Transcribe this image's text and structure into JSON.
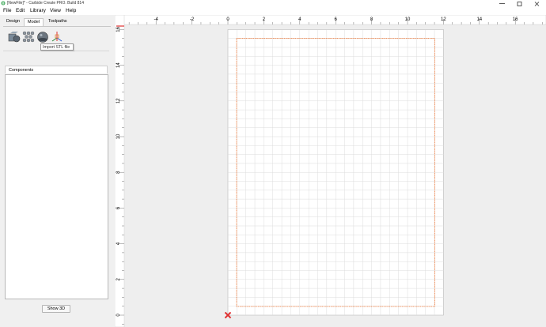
{
  "window": {
    "title": "[NewFile]* - Carbide Create PRO. Build 814",
    "minimize_icon": "minimize-icon",
    "maximize_icon": "maximize-icon",
    "close_icon": "close-icon"
  },
  "menu": {
    "items": [
      "File",
      "Edit",
      "Library",
      "View",
      "Help"
    ]
  },
  "panel": {
    "tabs": [
      "Design",
      "Model",
      "Toolpaths"
    ],
    "active_tab": "Model",
    "tools": [
      "import-3d-model-icon",
      "texture-icon",
      "dome-icon",
      "import-stl-icon"
    ],
    "tooltip": "Import STL file",
    "components_header": "Components",
    "show3d_button": "Show 3D"
  },
  "canvas": {
    "x_ticks": [
      "-4",
      "-2",
      "0",
      "2",
      "4",
      "6",
      "8",
      "10",
      "12",
      "14",
      "16"
    ],
    "y_ticks": [
      "0",
      "2",
      "4",
      "6",
      "8",
      "10",
      "12",
      "14",
      "16"
    ],
    "colors": {
      "background": "#eeeeee",
      "sheet": "#ffffff",
      "grid": "#d9d9d9",
      "boundary": "#f07a3a",
      "axis_marker": "#e03030"
    }
  }
}
